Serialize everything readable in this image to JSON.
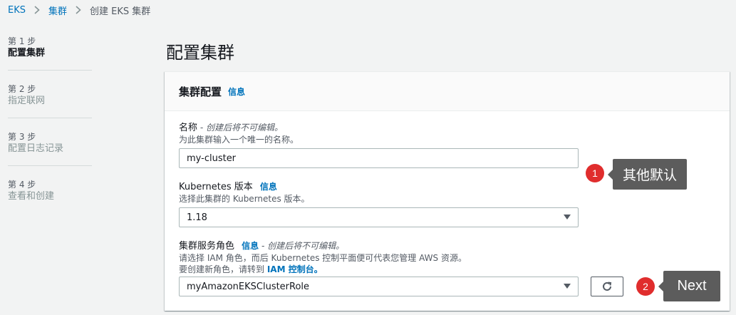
{
  "breadcrumb": {
    "items": [
      "EKS",
      "集群",
      "创建 EKS 集群"
    ]
  },
  "steps": [
    {
      "number": "第 1 步",
      "name": "配置集群",
      "active": true
    },
    {
      "number": "第 2 步",
      "name": "指定联网",
      "active": false
    },
    {
      "number": "第 3 步",
      "name": "配置日志记录",
      "active": false
    },
    {
      "number": "第 4 步",
      "name": "查看和创建",
      "active": false
    }
  ],
  "page_title": "配置集群",
  "panel": {
    "title": "集群配置",
    "info": "信息"
  },
  "fields": {
    "name": {
      "label": "名称",
      "hint": " - 创建后将不可编辑。",
      "desc": "为此集群输入一个唯一的名称。",
      "value": "my-cluster"
    },
    "k8s_version": {
      "label": "Kubernetes 版本",
      "info": "信息",
      "desc": "选择此集群的 Kubernetes 版本。",
      "value": "1.18"
    },
    "role": {
      "label": "集群服务角色",
      "info": "信息",
      "hint": " - 创建后将不可编辑。",
      "desc1": "请选择 IAM 角色，而后 Kubernetes 控制平面便可代表您管理 AWS 资源。",
      "desc2_prefix": "要创建新角色，请转到 ",
      "desc2_link": "IAM 控制台。",
      "value": "myAmazonEKSClusterRole"
    }
  },
  "callouts": [
    {
      "number": "1",
      "text": "其他默认"
    },
    {
      "number": "2",
      "text": "Next"
    }
  ],
  "colors": {
    "link": "#0073bb",
    "callout_badge": "#e02d2d",
    "callout_box": "#5c5c5c"
  }
}
